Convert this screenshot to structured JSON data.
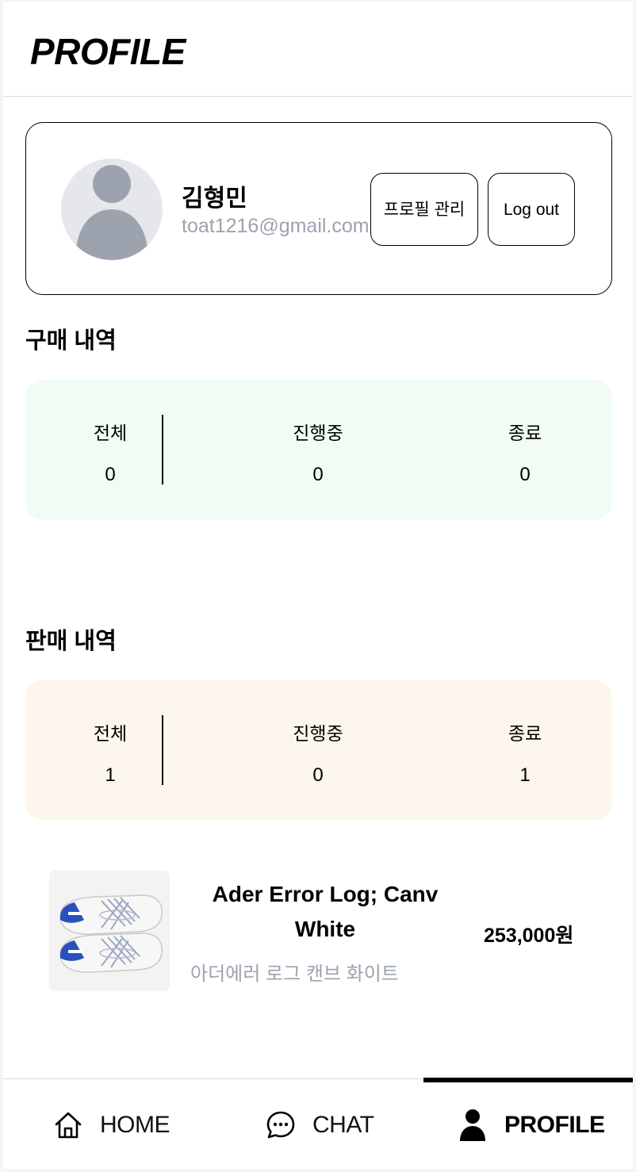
{
  "header": {
    "title": "PROFILE"
  },
  "profile": {
    "name": "김형민",
    "email": "toat1216@gmail.com",
    "manage_button": "프로필 관리",
    "logout_button": "Log out"
  },
  "purchase": {
    "title": "구매 내역",
    "stats": [
      {
        "label": "전체",
        "value": "0"
      },
      {
        "label": "진행중",
        "value": "0"
      },
      {
        "label": "종료",
        "value": "0"
      }
    ]
  },
  "sale": {
    "title": "판매 내역",
    "stats": [
      {
        "label": "전체",
        "value": "1"
      },
      {
        "label": "진행중",
        "value": "0"
      },
      {
        "label": "종료",
        "value": "1"
      }
    ]
  },
  "products": [
    {
      "name": "Ader Error Log; Canv White",
      "subname": "아더에러 로그 캔브 화이트",
      "price": "253,000원",
      "image": "sneakers-thumbnail"
    }
  ],
  "nav": {
    "items": [
      {
        "label": "HOME",
        "icon": "home-icon"
      },
      {
        "label": "CHAT",
        "icon": "chat-icon"
      },
      {
        "label": "PROFILE",
        "icon": "person-icon"
      }
    ],
    "active": "PROFILE"
  },
  "colors": {
    "purchase_bg": "#f0fcf4",
    "sale_bg": "#fdf6ec",
    "muted_text": "#9ca3af",
    "avatar_bg": "#e5e7eb"
  }
}
